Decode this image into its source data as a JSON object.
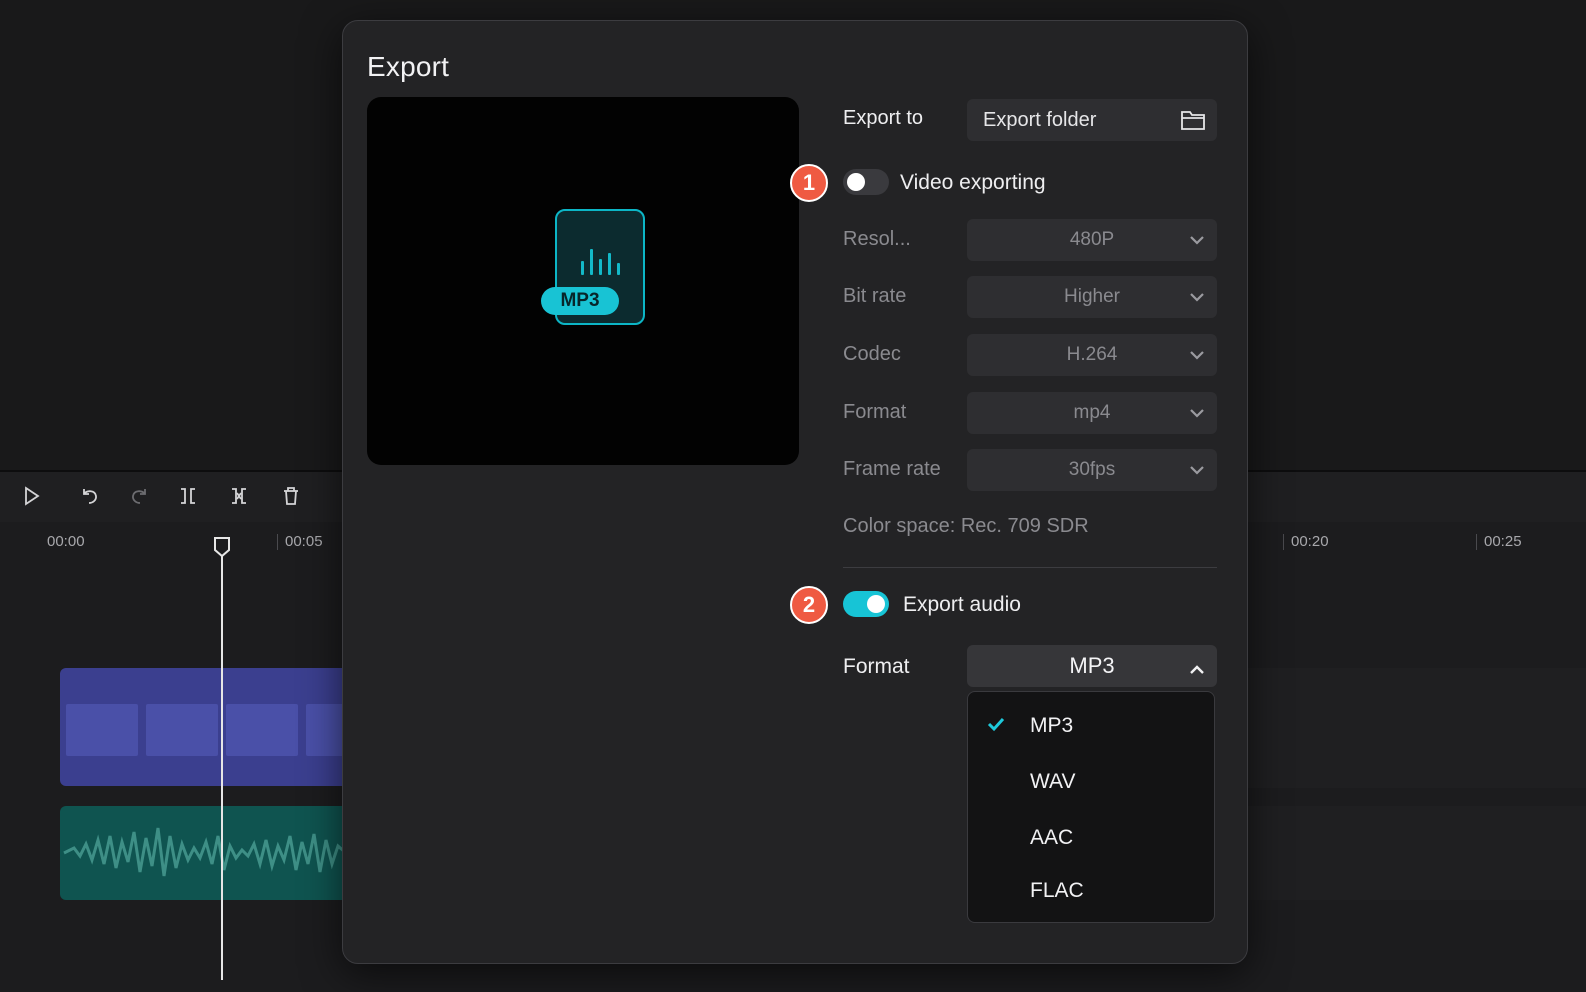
{
  "timeline": {
    "ticks": [
      "00:00",
      "00:05",
      "00:20",
      "00:25"
    ]
  },
  "dialog": {
    "title": "Export",
    "preview": {
      "file_badge": "MP3"
    },
    "export_to": {
      "label": "Export to",
      "value": "Export folder"
    },
    "video": {
      "step": "1",
      "toggle_label": "Video exporting",
      "enabled": false,
      "fields": [
        {
          "label": "Resol...",
          "value": "480P"
        },
        {
          "label": "Bit rate",
          "value": "Higher"
        },
        {
          "label": "Codec",
          "value": "H.264"
        },
        {
          "label": "Format",
          "value": "mp4"
        },
        {
          "label": "Frame rate",
          "value": "30fps"
        }
      ],
      "color_space": "Color space: Rec. 709 SDR"
    },
    "audio": {
      "step": "2",
      "toggle_label": "Export audio",
      "enabled": true,
      "format_label": "Format",
      "format_value": "MP3",
      "options": [
        "MP3",
        "WAV",
        "AAC",
        "FLAC"
      ],
      "selected": "MP3"
    }
  },
  "colors": {
    "accent": "#17c4d6",
    "badge": "#ef5a42",
    "dialog_bg": "#232325",
    "field_bg": "#2e2e31"
  }
}
